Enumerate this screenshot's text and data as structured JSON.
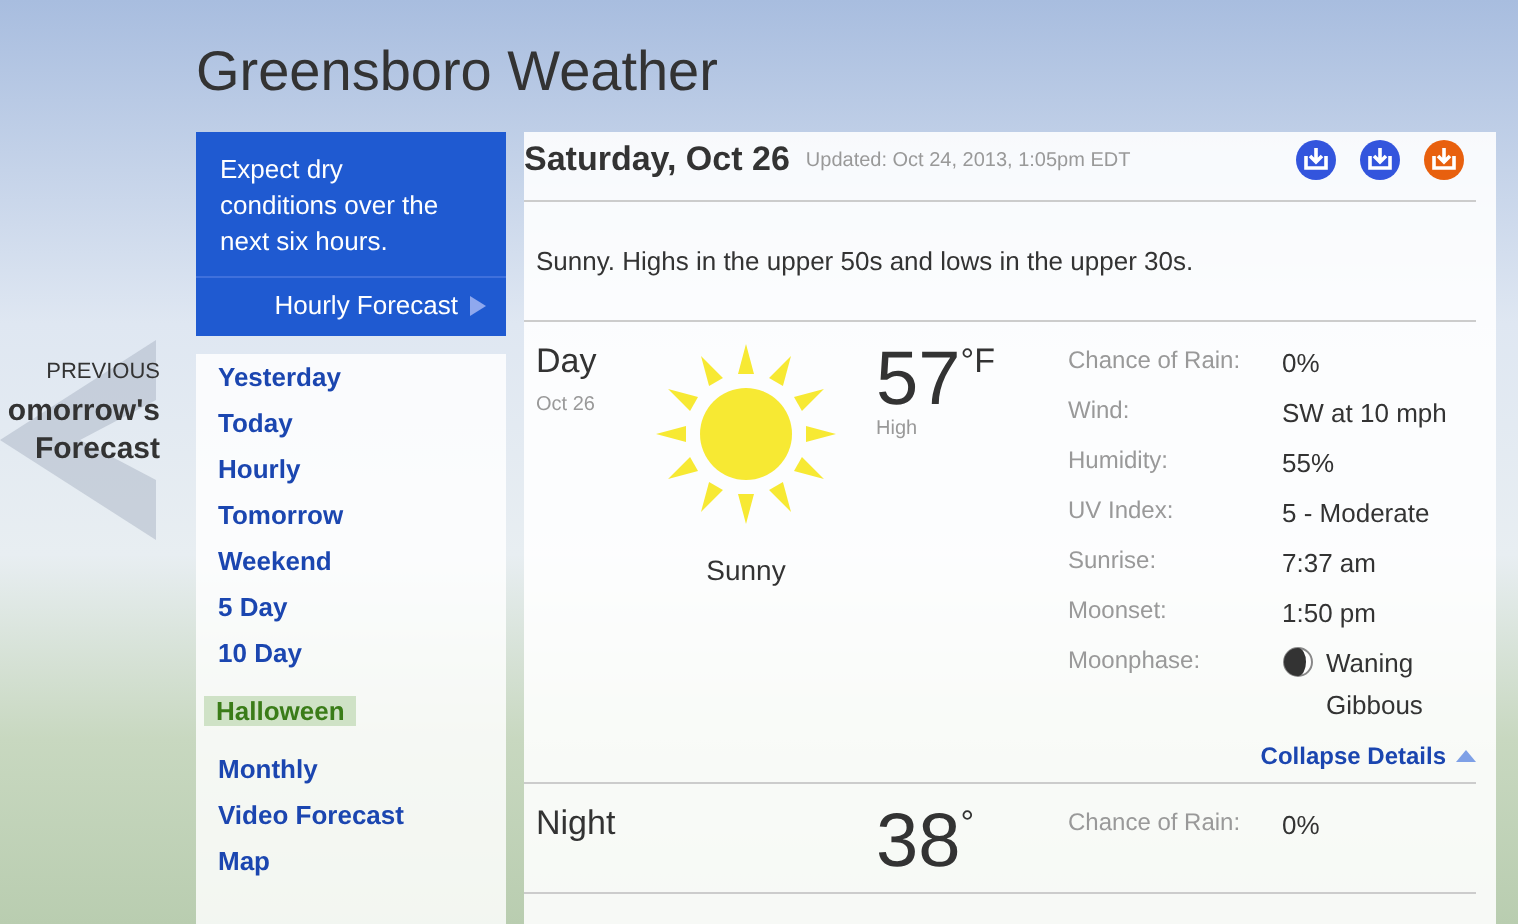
{
  "page_title": "Greensboro Weather",
  "previous": {
    "label": "PREVIOUS",
    "title": "omorrow's Forecast"
  },
  "alert": {
    "text": "Expect dry conditions over the next six hours.",
    "link": "Hourly Forecast"
  },
  "nav": [
    {
      "label": "Yesterday",
      "highlighted": false
    },
    {
      "label": "Today",
      "highlighted": false
    },
    {
      "label": "Hourly",
      "highlighted": false
    },
    {
      "label": "Tomorrow",
      "highlighted": false
    },
    {
      "label": "Weekend",
      "highlighted": false
    },
    {
      "label": "5 Day",
      "highlighted": false
    },
    {
      "label": "10 Day",
      "highlighted": false
    },
    {
      "label": "Halloween",
      "highlighted": true
    },
    {
      "label": "Monthly",
      "highlighted": false
    },
    {
      "label": "Video Forecast",
      "highlighted": false
    },
    {
      "label": "Map",
      "highlighted": false
    }
  ],
  "date": "Saturday, Oct 26",
  "updated": "Updated: Oct 24, 2013, 1:05pm EDT",
  "share_icons": [
    {
      "color": "#3355dd"
    },
    {
      "color": "#3355dd"
    },
    {
      "color": "#e8600e"
    }
  ],
  "summary": "Sunny. Highs in the upper 50s and lows in the upper 30s.",
  "periods": [
    {
      "name": "Day",
      "date": "Oct 26",
      "condition": "Sunny",
      "temp": "57",
      "unit": "°F",
      "temp_label": "High",
      "details": [
        {
          "label": "Chance of Rain:",
          "value": "0%"
        },
        {
          "label": "Wind:",
          "value": "SW at 10 mph"
        },
        {
          "label": "Humidity:",
          "value": "55%"
        },
        {
          "label": "UV Index:",
          "value": "5 - Moderate"
        },
        {
          "label": "Sunrise:",
          "value": "7:37 am"
        },
        {
          "label": "Moonset:",
          "value": "1:50 pm"
        },
        {
          "label": "Moonphase:",
          "value": "Waning Gibbous",
          "kind": "moon"
        }
      ],
      "collapse": "Collapse Details"
    },
    {
      "name": "Night",
      "temp": "38",
      "unit": "°",
      "details": [
        {
          "label": "Chance of Rain:",
          "value": "0%"
        }
      ]
    }
  ]
}
